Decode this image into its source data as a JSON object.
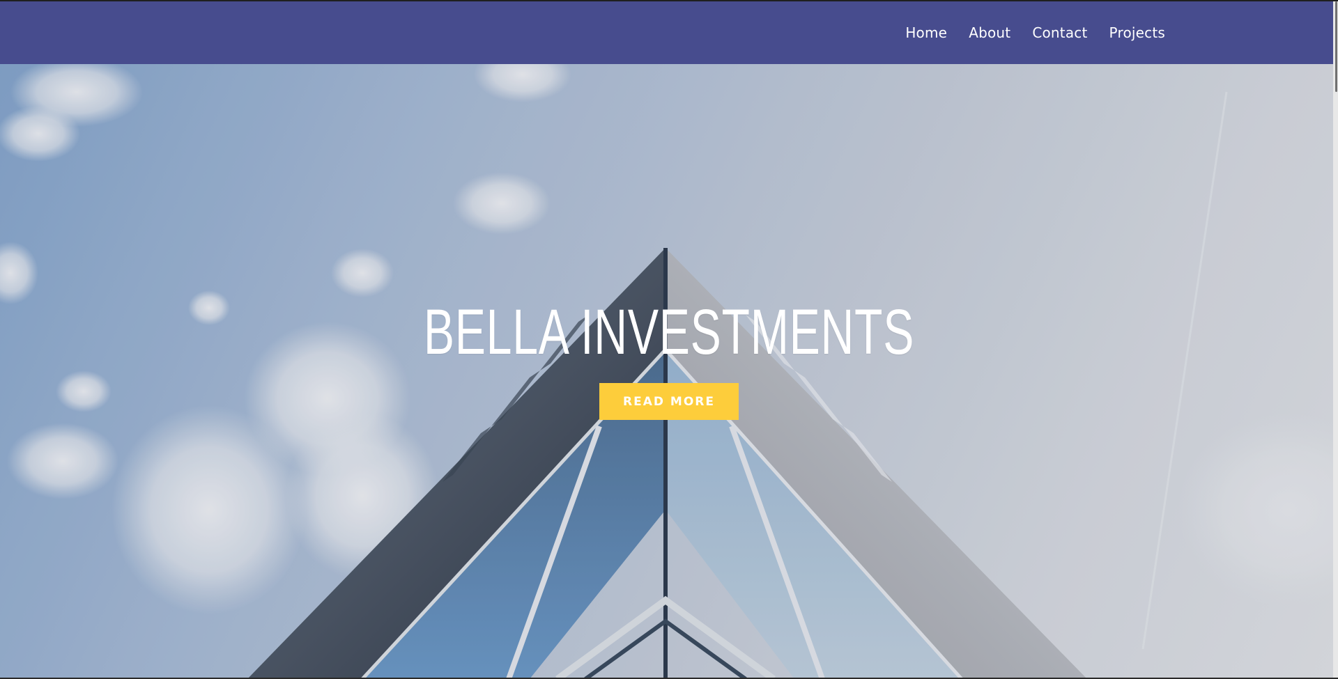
{
  "nav": {
    "items": [
      {
        "label": "Home"
      },
      {
        "label": "About"
      },
      {
        "label": "Contact"
      },
      {
        "label": "Projects"
      }
    ]
  },
  "hero": {
    "title": "BELLA INVESTMENTS",
    "button_label": "READ MORE",
    "background": "building-sky-photo"
  },
  "colors": {
    "navbar": "#474c8e",
    "button": "#fdcd3b",
    "hero_text": "#ffffff"
  }
}
